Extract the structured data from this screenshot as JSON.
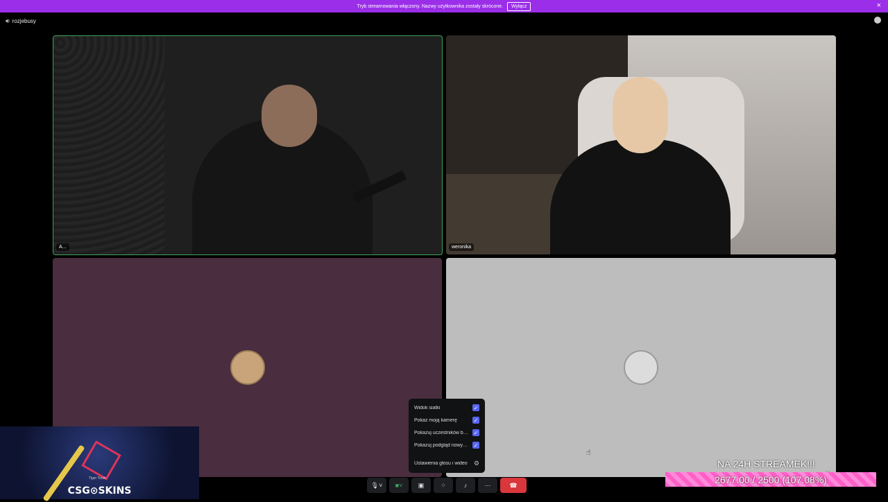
{
  "notice": {
    "text": "Tryb streamowania włączony. Nazwy użytkownika zostały skrócone.",
    "button_label": "Wyłącz",
    "close_icon": "×"
  },
  "header": {
    "channel_name": "rozjebusy"
  },
  "tiles": [
    {
      "label": "A..."
    },
    {
      "label": "weronika"
    }
  ],
  "popup": {
    "items": [
      {
        "label": "Widok siatki",
        "checked": true
      },
      {
        "label": "Pokaż moją kamerę",
        "checked": true
      },
      {
        "label": "Pokazuj uczestników bez wideo",
        "checked": true
      },
      {
        "label": "Pokazuj podgląd nowych transmisji",
        "checked": true
      }
    ],
    "settings_label": "Ustawienia głosu i wideo"
  },
  "controls": {
    "end_call_color": "#da373c"
  },
  "ad": {
    "brand": "CSG⊙SKINS",
    "item_name": "Tiger Tooth"
  },
  "goal": {
    "title": "NA 24H STREAMEK!!!",
    "progress_text": "2677.00 / 2500 (107.08%)",
    "progress_fraction": 1.0708
  },
  "colors": {
    "notice_bg": "#9b2ee8",
    "speaking_border": "#3ba55c",
    "checkbox": "#5865f2"
  }
}
